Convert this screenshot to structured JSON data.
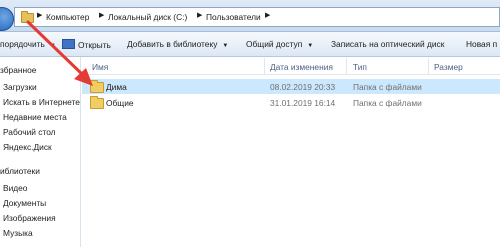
{
  "address": {
    "breadcrumbs": [
      "Компьютер",
      "Локальный диск (C:)",
      "Пользователи"
    ]
  },
  "toolbar": {
    "organize": "порядочить",
    "open": "Открыть",
    "add_to_library": "Добавить в библиотеку",
    "share": "Общий доступ",
    "burn": "Записать на оптический диск",
    "new_folder": "Новая п"
  },
  "nav": {
    "favorites": "збранное",
    "downloads": "Загрузки",
    "search_internet": "Искать в Интернете",
    "recent": "Недавние места",
    "desktop": "Рабочий стол",
    "yandex": "Яндекс.Диск",
    "libraries": "иблиотеки",
    "video": "Видео",
    "documents": "Документы",
    "images": "Изображения",
    "music": "Музыка"
  },
  "columns": {
    "name": "Имя",
    "date": "Дата изменения",
    "type": "Тип",
    "size": "Размер"
  },
  "files": [
    {
      "name": "Дима",
      "date": "08.02.2019 20:33",
      "type": "Папка с файлами",
      "selected": true
    },
    {
      "name": "Общие",
      "date": "31.01.2019 16:14",
      "type": "Папка с файлами",
      "selected": false
    }
  ],
  "icons": {
    "folder": "folder-icon",
    "annotation": "red-arrow-annotation"
  },
  "colors": {
    "selection": "#cce8ff",
    "annotation_arrow": "#e53935"
  }
}
